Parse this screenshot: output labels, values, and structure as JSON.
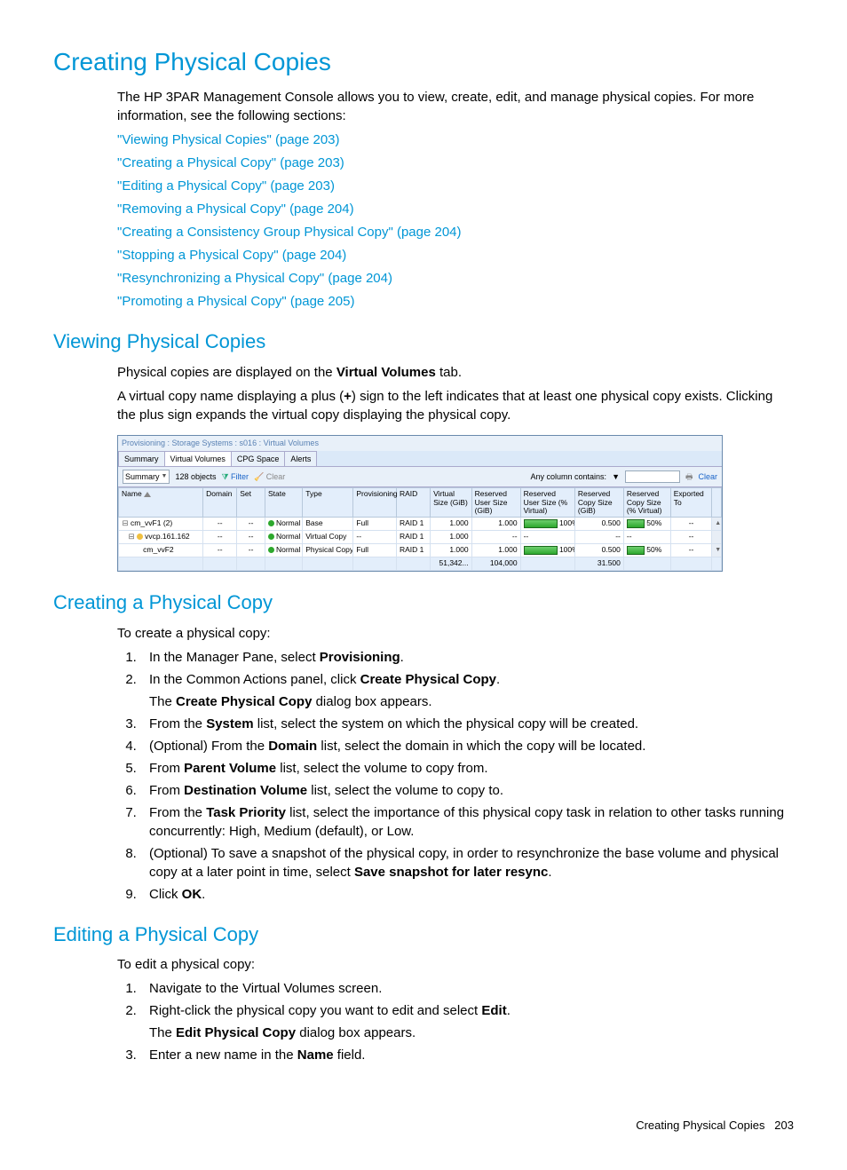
{
  "h1": "Creating Physical Copies",
  "intro": "The HP 3PAR Management Console allows you to view, create, edit, and manage physical copies. For more information, see the following sections:",
  "links": [
    "\"Viewing Physical Copies\" (page 203)",
    "\"Creating a Physical Copy\" (page 203)",
    "\"Editing a Physical Copy\" (page 203)",
    "\"Removing a Physical Copy\" (page 204)",
    "\"Creating a Consistency Group Physical Copy\" (page 204)",
    "\"Stopping a Physical Copy\" (page 204)",
    "\"Resynchronizing a Physical Copy\" (page 204)",
    "\"Promoting a Physical Copy\" (page 205)"
  ],
  "sec_view": {
    "title": "Viewing Physical Copies",
    "p1a": "Physical copies are displayed on the ",
    "p1b": "Virtual Volumes",
    "p1c": " tab.",
    "p2a": "A virtual copy name displaying a plus (",
    "p2b": "+",
    "p2c": ") sign to the left indicates that at least one physical copy exists. Clicking the plus sign expands the virtual copy displaying the physical copy."
  },
  "screenshot": {
    "breadcrumb": "Provisioning : Storage Systems : s016 : Virtual Volumes",
    "tabs": [
      "Summary",
      "Virtual Volumes",
      "CPG Space",
      "Alerts"
    ],
    "toolbar": {
      "summary": "Summary",
      "objects": "128 objects",
      "filter": "Filter",
      "clear": "Clear",
      "any_col": "Any column contains:",
      "clear_right": "Clear"
    },
    "headers": [
      "Name",
      "Domain",
      "Set",
      "State",
      "Type",
      "Provisioning",
      "RAID",
      "Virtual Size (GiB)",
      "Reserved User Size (GiB)",
      "Reserved User Size (% Virtual)",
      "Reserved Copy Size (GiB)",
      "Reserved Copy Size (% Virtual)",
      "Exported To"
    ],
    "rows": [
      {
        "name": "cm_vvF1  (2)",
        "domain": "--",
        "set": "--",
        "state": "Normal",
        "type": "Base",
        "prov": "Full",
        "raid": "RAID 1",
        "vs": "1.000",
        "rus": "1.000",
        "rusp": "100%",
        "rcs": "0.500",
        "rcsp": "50%",
        "exp": "--",
        "indent": 0,
        "tree": "⊟",
        "dot": "g"
      },
      {
        "name": "vvcp.161.162",
        "domain": "--",
        "set": "--",
        "state": "Normal",
        "type": "Virtual Copy",
        "prov": "--",
        "raid": "RAID 1",
        "vs": "1.000",
        "rus": "--",
        "rusp": "--",
        "rcs": "--",
        "rcsp": "--",
        "exp": "--",
        "indent": 1,
        "tree": "⊟",
        "dot": "y"
      },
      {
        "name": "cm_vvF2",
        "domain": "--",
        "set": "--",
        "state": "Normal",
        "type": "Physical Copy",
        "prov": "Full",
        "raid": "RAID 1",
        "vs": "1.000",
        "rus": "1.000",
        "rusp": "100%",
        "rcs": "0.500",
        "rcsp": "50%",
        "exp": "--",
        "indent": 2,
        "tree": "",
        "dot": ""
      }
    ],
    "totals": {
      "vs": "51,342...",
      "rus": "104,000",
      "rcs": "31.500"
    }
  },
  "sec_create": {
    "title": "Creating a Physical Copy",
    "intro": "To create a physical copy:",
    "steps": [
      {
        "t": [
          "In the Manager Pane, select ",
          {
            "b": "Provisioning"
          },
          "."
        ]
      },
      {
        "t": [
          "In the Common Actions panel, click ",
          {
            "b": "Create Physical Copy"
          },
          "."
        ],
        "after": [
          "The ",
          {
            "b": "Create Physical Copy"
          },
          " dialog box appears."
        ]
      },
      {
        "t": [
          "From the ",
          {
            "b": "System"
          },
          " list, select the system on which the physical copy will be created."
        ]
      },
      {
        "t": [
          "(Optional) From the ",
          {
            "b": "Domain"
          },
          " list, select the domain in which the copy will be located."
        ]
      },
      {
        "t": [
          "From ",
          {
            "b": "Parent Volume"
          },
          " list, select the volume to copy from."
        ]
      },
      {
        "t": [
          "From ",
          {
            "b": "Destination Volume"
          },
          " list, select the volume to copy to."
        ]
      },
      {
        "t": [
          "From the ",
          {
            "b": "Task Priority"
          },
          " list, select the importance of this physical copy task in relation to other tasks running concurrently: High, Medium (default), or Low."
        ]
      },
      {
        "t": [
          "(Optional) To save a snapshot of the physical copy, in order to resynchronize the base volume and physical copy at a later point in time, select ",
          {
            "b": "Save snapshot for later resync"
          },
          "."
        ]
      },
      {
        "t": [
          "Click ",
          {
            "b": "OK"
          },
          "."
        ]
      }
    ]
  },
  "sec_edit": {
    "title": "Editing a Physical Copy",
    "intro": "To edit a physical copy:",
    "steps": [
      {
        "t": [
          "Navigate to the Virtual Volumes screen."
        ]
      },
      {
        "t": [
          "Right-click the physical copy you want to edit and select ",
          {
            "b": "Edit"
          },
          "."
        ],
        "after": [
          "The ",
          {
            "b": "Edit Physical Copy"
          },
          " dialog box appears."
        ]
      },
      {
        "t": [
          "Enter a new name in the ",
          {
            "b": "Name"
          },
          " field."
        ]
      }
    ]
  },
  "footer": {
    "text": "Creating Physical Copies",
    "page": "203"
  }
}
